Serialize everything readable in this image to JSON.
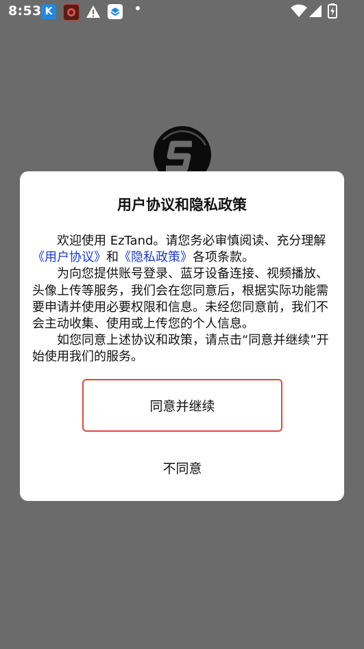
{
  "status_bar": {
    "time": "8:53",
    "apps": [
      {
        "icon": "k-app-icon",
        "glyph": "K",
        "color": "#1e88e5"
      },
      {
        "icon": "red-app-icon",
        "glyph": "⚙",
        "color": "#7a2a1f"
      },
      {
        "icon": "layers-app-icon",
        "glyph": "◆",
        "color": "#ffffff"
      }
    ]
  },
  "dialog": {
    "title": "用户协议和隐私政策",
    "p1_a": "欢迎使用 EzTand。请您务必审慎阅读、充分理解",
    "user_agreement_link": "《用户协议》",
    "p1_b": "和",
    "privacy_policy_link": "《隐私政策》",
    "p1_c": "各项条款。",
    "p2": "为向您提供账号登录、蓝牙设备连接、视频播放、头像上传等服务，我们会在您同意后，根据实际功能需要申请并使用必要权限和信息。未经您同意前，我们不会主动收集、使用或上传您的个人信息。",
    "p3": "如您同意上述协议和政策，请点击“同意并继续”开始使用我们的服务。",
    "agree_button": "同意并继续",
    "disagree_button": "不同意"
  },
  "colors": {
    "link": "#1a3ad1",
    "agree_border": "#e0473b",
    "overlay": "#6b6b6b"
  }
}
